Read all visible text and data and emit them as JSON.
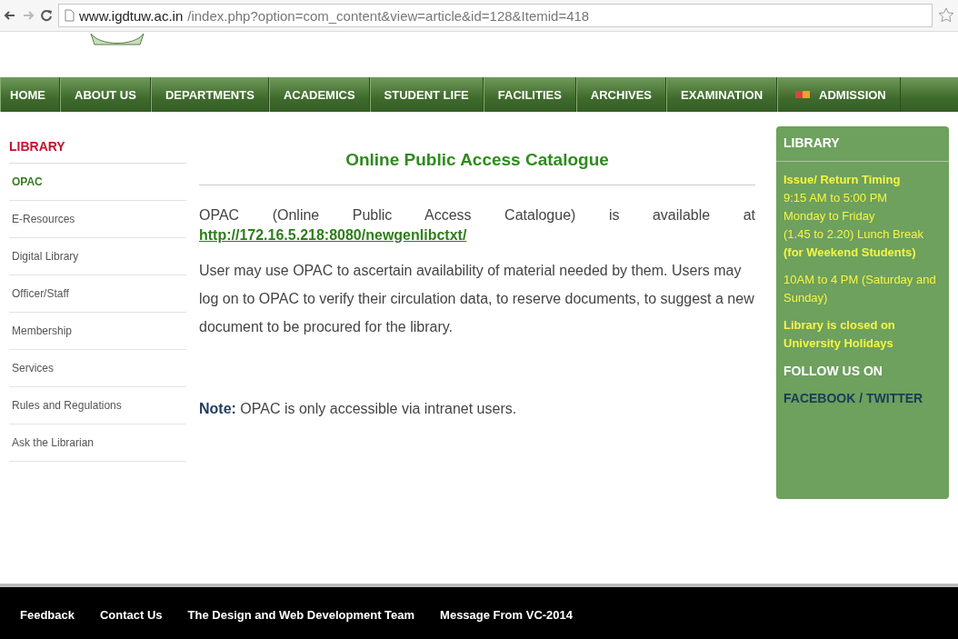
{
  "browser": {
    "url_host": "www.igdtuw.ac.in",
    "url_path": "/index.php?option=com_content&view=article&id=128&Itemid=418"
  },
  "nav": [
    {
      "label": "HOME",
      "kind": "plain"
    },
    {
      "label": "ABOUT US",
      "kind": "plain"
    },
    {
      "label": "DEPARTMENTS",
      "kind": "plain"
    },
    {
      "label": "ACADEMICS",
      "kind": "plain"
    },
    {
      "label": "STUDENT LIFE",
      "kind": "plain"
    },
    {
      "label": "FACILITIES",
      "kind": "plain"
    },
    {
      "label": "ARCHIVES",
      "kind": "plain"
    },
    {
      "label": "EXAMINATION",
      "kind": "plain"
    },
    {
      "label": "ADMISSION",
      "kind": "flag"
    }
  ],
  "sidebar": {
    "title": "LIBRARY",
    "items": [
      {
        "label": "OPAC",
        "selected": true
      },
      {
        "label": "E-Resources",
        "selected": false
      },
      {
        "label": "Digital Library",
        "selected": false
      },
      {
        "label": "Officer/Staff",
        "selected": false
      },
      {
        "label": "Membership",
        "selected": false
      },
      {
        "label": "Services",
        "selected": false
      },
      {
        "label": "Rules and Regulations",
        "selected": false
      },
      {
        "label": "Ask the Librarian",
        "selected": false
      }
    ]
  },
  "article": {
    "title": "Online Public Access Catalogue",
    "intro": "OPAC (Online Public Access Catalogue) is available at",
    "link": "http://172.16.5.218:8080/newgenlibctxt/",
    "body": "User may use OPAC to ascertain availability of material needed by them. Users may log on to OPAC to verify their circulation data, to reserve documents, to suggest a new document to be procured for the library.",
    "note": "**Note:** OPAC is only accessible via intranet users."
  },
  "panel": {
    "title": "LIBRARY",
    "groups": [
      [
        {
          "text": "Issue/ Return Timing",
          "kind": "bold"
        },
        {
          "text": "9:15 AM to 5:00 PM",
          "kind": "plain"
        },
        {
          "text": "Monday to Friday",
          "kind": "plain"
        },
        {
          "text": "(1.45 to 2.20) Lunch Break",
          "kind": "plain"
        },
        {
          "text": "(for Weekend Students)",
          "kind": "bold"
        }
      ],
      [
        {
          "text": "10AM  to 4 PM (Saturday and Sunday)",
          "kind": "plain"
        }
      ],
      [
        {
          "text": "Library is closed on University Holidays",
          "kind": "bold"
        }
      ],
      [
        {
          "text": "FOLLOW US ON",
          "kind": "heading"
        }
      ],
      [
        {
          "text": "FACEBOOK / TWITTER",
          "kind": "link"
        }
      ]
    ]
  },
  "footer": [
    "Feedback",
    "Contact Us",
    "The Design and Web Development Team",
    "Message From VC-2014"
  ]
}
